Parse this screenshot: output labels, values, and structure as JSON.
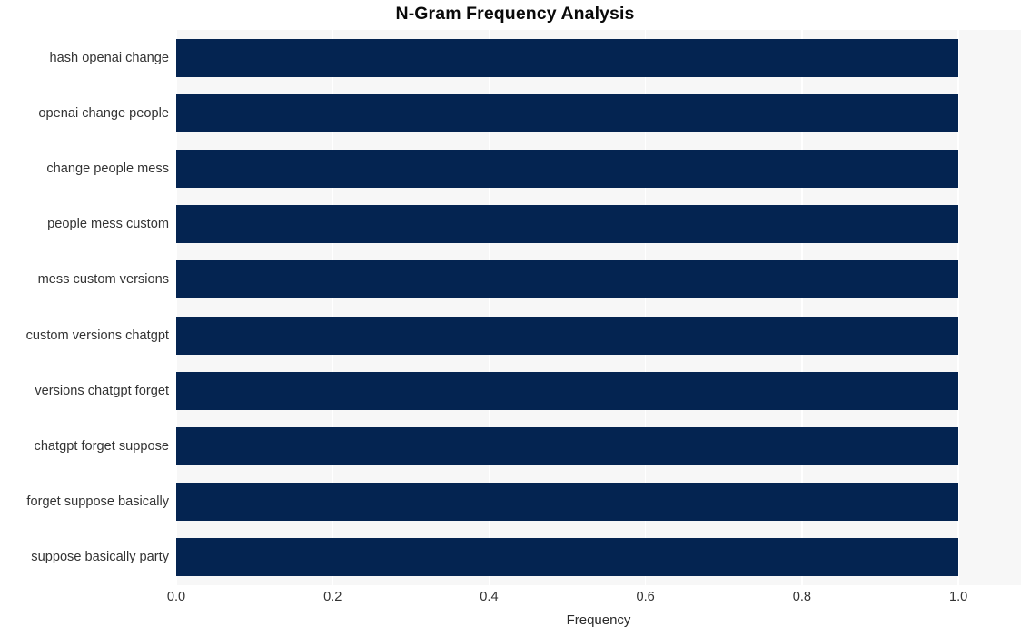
{
  "chart_data": {
    "type": "bar",
    "orientation": "horizontal",
    "title": "N-Gram Frequency Analysis",
    "xlabel": "Frequency",
    "ylabel": "",
    "categories": [
      "hash openai change",
      "openai change people",
      "change people mess",
      "people mess custom",
      "mess custom versions",
      "custom versions chatgpt",
      "versions chatgpt forget",
      "chatgpt forget suppose",
      "forget suppose basically",
      "suppose basically party"
    ],
    "values": [
      1.0,
      1.0,
      1.0,
      1.0,
      1.0,
      1.0,
      1.0,
      1.0,
      1.0,
      1.0
    ],
    "xlim": [
      0.0,
      1.08
    ],
    "xticks": [
      0.0,
      0.2,
      0.4,
      0.6,
      0.8,
      1.0
    ],
    "xtick_labels": [
      "0.0",
      "0.2",
      "0.4",
      "0.6",
      "0.8",
      "1.0"
    ],
    "grid": "vertical-white",
    "legend": null,
    "bar_color": "#042451",
    "plot_background": "#f7f7f7",
    "figure_background": "#ffffff"
  }
}
